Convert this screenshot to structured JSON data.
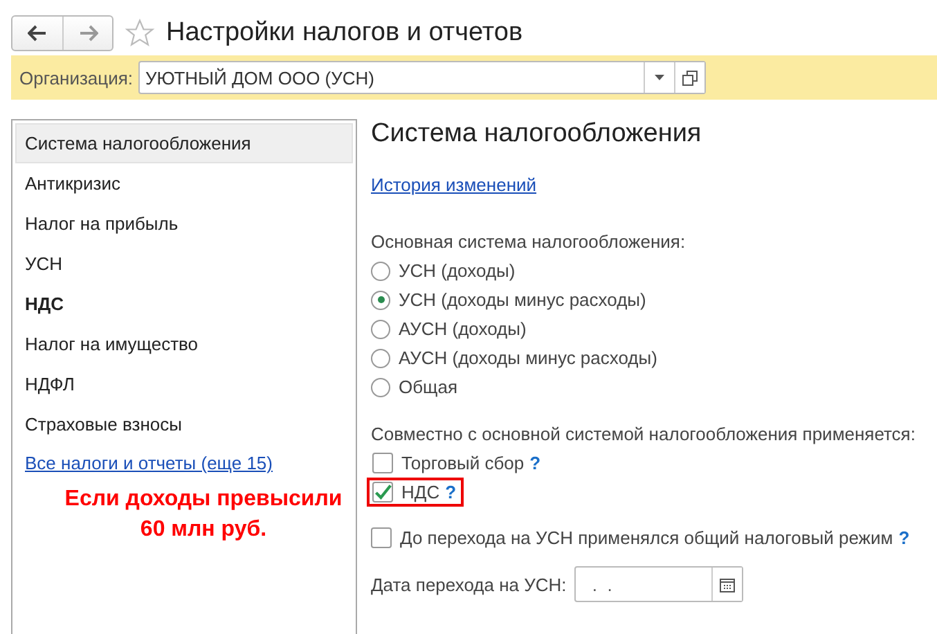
{
  "window": {
    "title": "Настройки налогов и отчетов",
    "favorite": false
  },
  "organization": {
    "label": "Организация:",
    "value": "УЮТНЫЙ ДОМ ООО (УСН)"
  },
  "sidebar": {
    "items": [
      {
        "label": "Система налогообложения",
        "selected": true,
        "bold": false
      },
      {
        "label": "Антикризис",
        "selected": false,
        "bold": false
      },
      {
        "label": "Налог на прибыль",
        "selected": false,
        "bold": false
      },
      {
        "label": "УСН",
        "selected": false,
        "bold": false
      },
      {
        "label": "НДС",
        "selected": false,
        "bold": true
      },
      {
        "label": "Налог на имущество",
        "selected": false,
        "bold": false
      },
      {
        "label": "НДФЛ",
        "selected": false,
        "bold": false
      },
      {
        "label": "Страховые взносы",
        "selected": false,
        "bold": false
      }
    ],
    "link": "Все налоги и отчеты (еще 15)",
    "annotation": "Если доходы превысили 60 млн руб."
  },
  "content": {
    "title": "Система налогообложения",
    "history_link": "История изменений",
    "main_system": {
      "label": "Основная система налогообложения:",
      "options": [
        {
          "label": "УСН (доходы)",
          "selected": false
        },
        {
          "label": "УСН (доходы минус расходы)",
          "selected": true
        },
        {
          "label": "АУСН (доходы)",
          "selected": false
        },
        {
          "label": "АУСН (доходы минус расходы)",
          "selected": false
        },
        {
          "label": "Общая",
          "selected": false
        }
      ]
    },
    "combined": {
      "label": "Совместно с основной системой налогообложения применяется:",
      "items": [
        {
          "label": "Торговый сбор",
          "checked": false,
          "help": "?",
          "highlighted": false
        },
        {
          "label": "НДС",
          "checked": true,
          "help": "?",
          "highlighted": true
        }
      ]
    },
    "previous_regime": {
      "label": "До перехода на УСН применялся общий налоговый режим",
      "checked": false,
      "help": "?"
    },
    "transition_date": {
      "label": "Дата перехода на УСН:",
      "value": " .  ."
    }
  }
}
